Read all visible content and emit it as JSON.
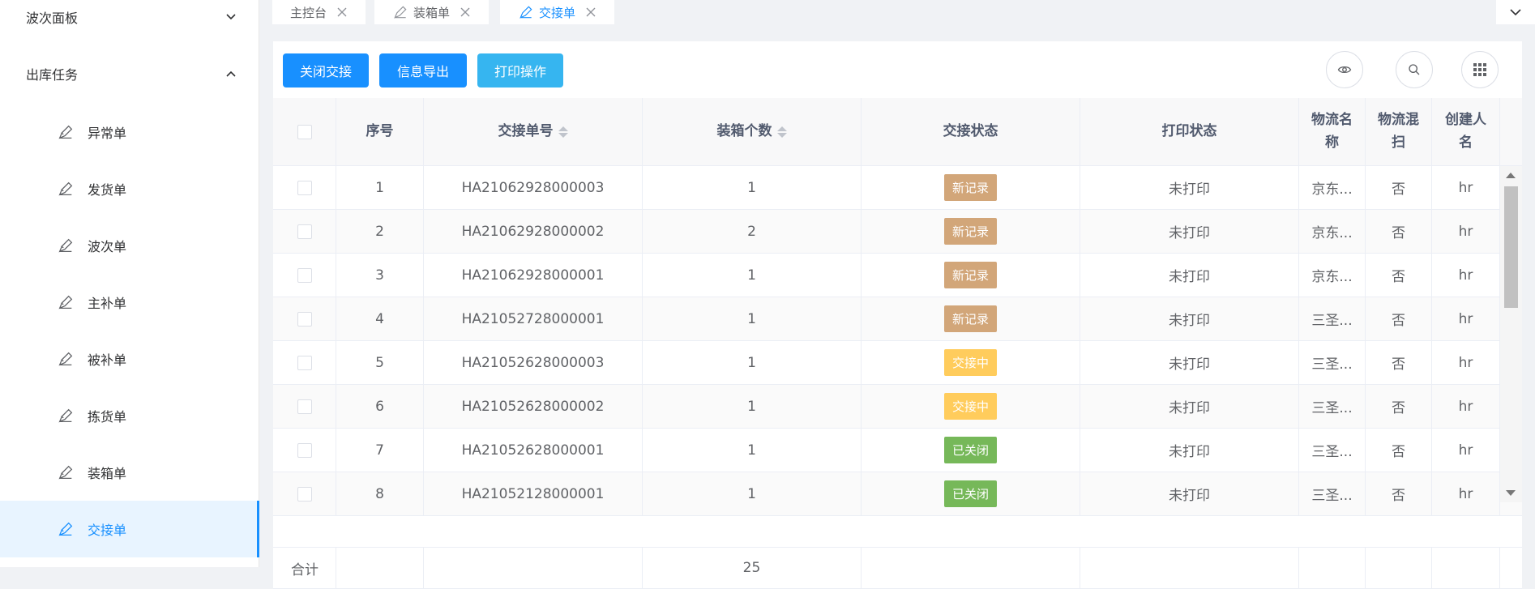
{
  "sidebar": {
    "groups": [
      {
        "label": "波次面板"
      },
      {
        "label": "出库任务"
      }
    ],
    "items": [
      {
        "label": "异常单"
      },
      {
        "label": "发货单"
      },
      {
        "label": "波次单"
      },
      {
        "label": "主补单"
      },
      {
        "label": "被补单"
      },
      {
        "label": "拣货单"
      },
      {
        "label": "装箱单"
      },
      {
        "label": "交接单"
      }
    ],
    "active_item": "交接单"
  },
  "tabs": [
    {
      "label": "主控台"
    },
    {
      "label": "装箱单"
    },
    {
      "label": "交接单"
    }
  ],
  "toolbar": {
    "buttons": [
      {
        "label": "关闭交接"
      },
      {
        "label": "信息导出"
      },
      {
        "label": "打印操作"
      }
    ],
    "icons": [
      "eye-icon",
      "search-icon",
      "grid-icon"
    ]
  },
  "table": {
    "headers": {
      "seq": "序号",
      "handover_no": "交接单号",
      "box_count": "装箱个数",
      "handover_status": "交接状态",
      "print_status": "打印状态",
      "logistics_name": "物流名称",
      "logistics_mixed": "物流混扫",
      "creator": "创建人名"
    },
    "rows": [
      {
        "seq": "1",
        "no": "HA21062928000003",
        "boxes": "1",
        "status": "新记录",
        "print": "未打印",
        "logistics": "京东...",
        "mixed": "否",
        "creator": "hr"
      },
      {
        "seq": "2",
        "no": "HA21062928000002",
        "boxes": "2",
        "status": "新记录",
        "print": "未打印",
        "logistics": "京东...",
        "mixed": "否",
        "creator": "hr"
      },
      {
        "seq": "3",
        "no": "HA21062928000001",
        "boxes": "1",
        "status": "新记录",
        "print": "未打印",
        "logistics": "京东...",
        "mixed": "否",
        "creator": "hr"
      },
      {
        "seq": "4",
        "no": "HA21052728000001",
        "boxes": "1",
        "status": "新记录",
        "print": "未打印",
        "logistics": "三圣...",
        "mixed": "否",
        "creator": "hr"
      },
      {
        "seq": "5",
        "no": "HA21052628000003",
        "boxes": "1",
        "status": "交接中",
        "print": "未打印",
        "logistics": "三圣...",
        "mixed": "否",
        "creator": "hr"
      },
      {
        "seq": "6",
        "no": "HA21052628000002",
        "boxes": "1",
        "status": "交接中",
        "print": "未打印",
        "logistics": "三圣...",
        "mixed": "否",
        "creator": "hr"
      },
      {
        "seq": "7",
        "no": "HA21052628000001",
        "boxes": "1",
        "status": "已关闭",
        "print": "未打印",
        "logistics": "三圣...",
        "mixed": "否",
        "creator": "hr"
      },
      {
        "seq": "8",
        "no": "HA21052128000001",
        "boxes": "1",
        "status": "已关闭",
        "print": "未打印",
        "logistics": "三圣...",
        "mixed": "否",
        "creator": "hr"
      }
    ],
    "footer": {
      "label": "合计",
      "box_total": "25"
    }
  },
  "colors": {
    "primary": "#1890ff",
    "cyan": "#36b5f0",
    "status_new": "#d2a679",
    "status_in_progress": "#ffcc5c",
    "status_closed": "#76b859"
  }
}
